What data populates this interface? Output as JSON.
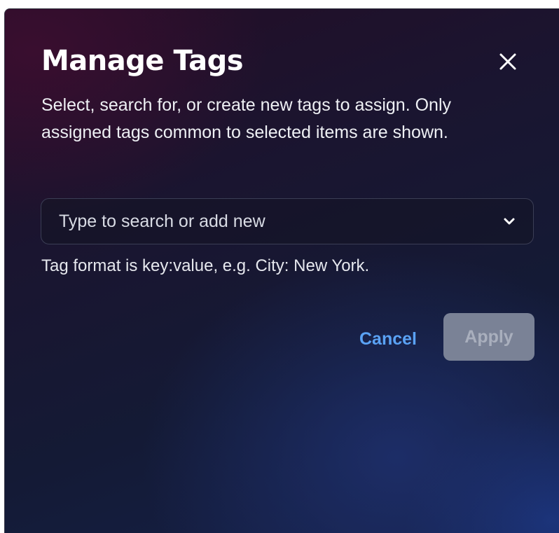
{
  "dialog": {
    "title": "Manage Tags",
    "close_icon": "close-icon",
    "description": "Select, search for, or create new tags to assign. Only assigned tags common to selected items are shown.",
    "search": {
      "placeholder": "Type to search or add new",
      "value": "",
      "dropdown_icon": "chevron-down-icon"
    },
    "hint": "Tag format is key:value, e.g. City: New York.",
    "actions": {
      "cancel_label": "Cancel",
      "apply_label": "Apply",
      "apply_enabled": false
    },
    "colors": {
      "accent_link": "#5aa2f4",
      "apply_disabled_bg": "#7a8296",
      "text_primary": "#ffffff"
    }
  }
}
